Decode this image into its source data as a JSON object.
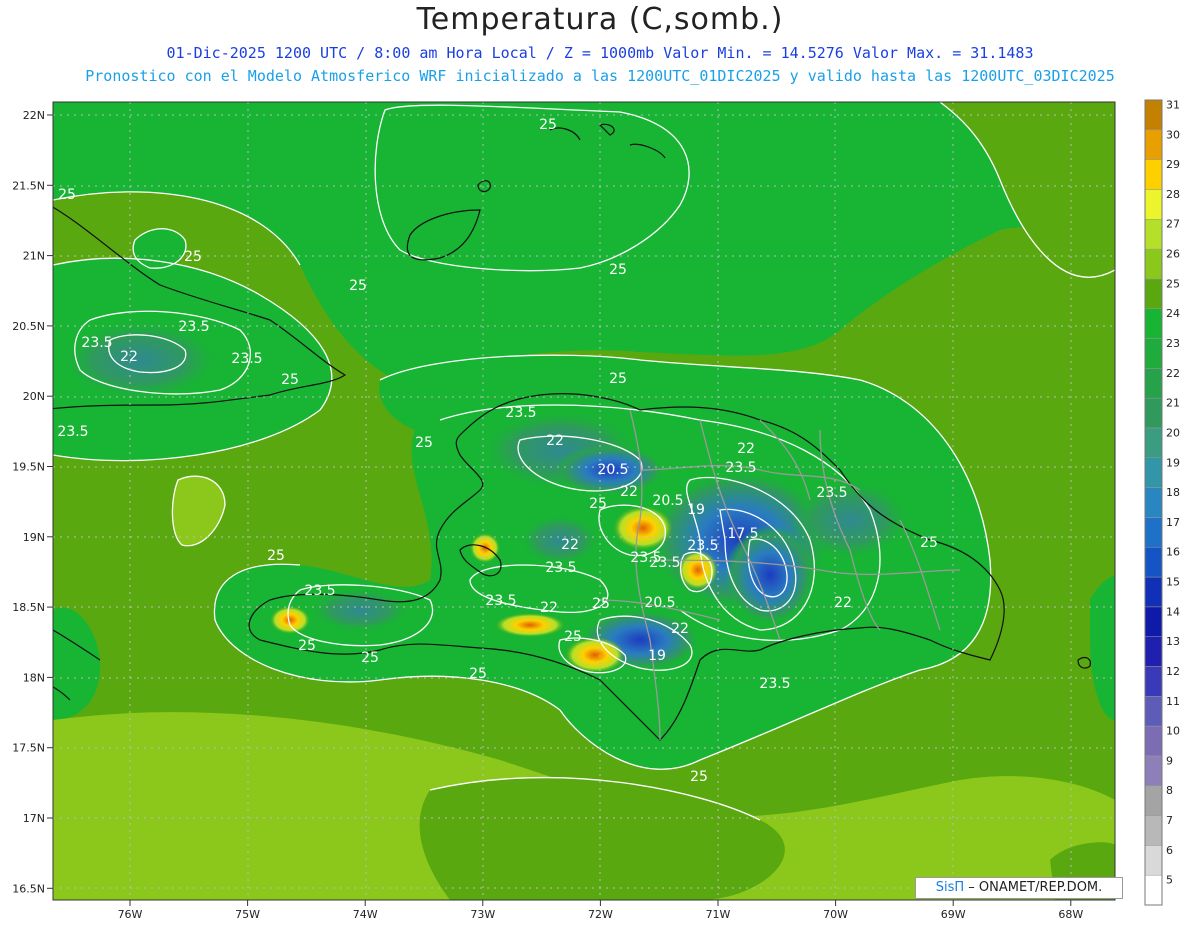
{
  "header": {
    "title": "Temperatura (C,somb.)",
    "subtitle_date": "01-Dic-2025  1200 UTC / 8:00 am Hora Local / Z = 1000mb   Valor Min. = 14.5276  Valor Max. = 31.1483",
    "subtitle_model": "Pronostico con el Modelo Atmosferico WRF inicializado a las 1200UTC_01DIC2025 y valido hasta las  1200UTC_03DIC2025"
  },
  "credit": {
    "brand": "SisΠ",
    "org": " – ONAMET/REP.DOM."
  },
  "axes": {
    "lat_ticks": [
      "22N",
      "21.5N",
      "21N",
      "20.5N",
      "20N",
      "19.5N",
      "19N",
      "18.5N",
      "18N",
      "17.5N",
      "17N",
      "16.5N"
    ],
    "lon_ticks": [
      "76W",
      "75W",
      "74W",
      "73W",
      "72W",
      "71W",
      "70W",
      "69W",
      "68W"
    ]
  },
  "colorbar": {
    "labels": [
      "5",
      "6",
      "7",
      "8",
      "9",
      "10",
      "11",
      "12",
      "13",
      "14",
      "15",
      "16",
      "17",
      "18",
      "19",
      "20",
      "21",
      "22",
      "23",
      "24",
      "25",
      "26",
      "27",
      "28",
      "29",
      "30",
      "31"
    ],
    "colors": [
      "#ffffff",
      "#d9d9d9",
      "#b8b8b8",
      "#a4a4a4",
      "#8f7fb8",
      "#7c6cb4",
      "#5d5db8",
      "#3a3ab8",
      "#1f1fb0",
      "#0f1aa8",
      "#1030b8",
      "#1454c4",
      "#1d72c8",
      "#2886c0",
      "#3296a8",
      "#3a9c80",
      "#2f9a5c",
      "#26a24a",
      "#1fac3c",
      "#18b434",
      "#5aa810",
      "#8cc81c",
      "#b4e02a",
      "#ecf42c",
      "#ffd000",
      "#e8a000",
      "#c48000"
    ]
  },
  "contour_labels": [
    "25",
    "25",
    "25",
    "25",
    "25",
    "25",
    "25",
    "25",
    "25",
    "25",
    "25",
    "25",
    "25",
    "25",
    "25",
    "25",
    "25",
    "23.5",
    "23.5",
    "23.5",
    "23.5",
    "23.5",
    "23.5",
    "23.5",
    "23.5",
    "23.5",
    "23.5",
    "23.5",
    "23.5",
    "23.5",
    "23.5",
    "22",
    "22",
    "22",
    "22",
    "22",
    "22",
    "22",
    "22",
    "20.5",
    "20.5",
    "20.5",
    "19",
    "19",
    "17.5"
  ]
}
